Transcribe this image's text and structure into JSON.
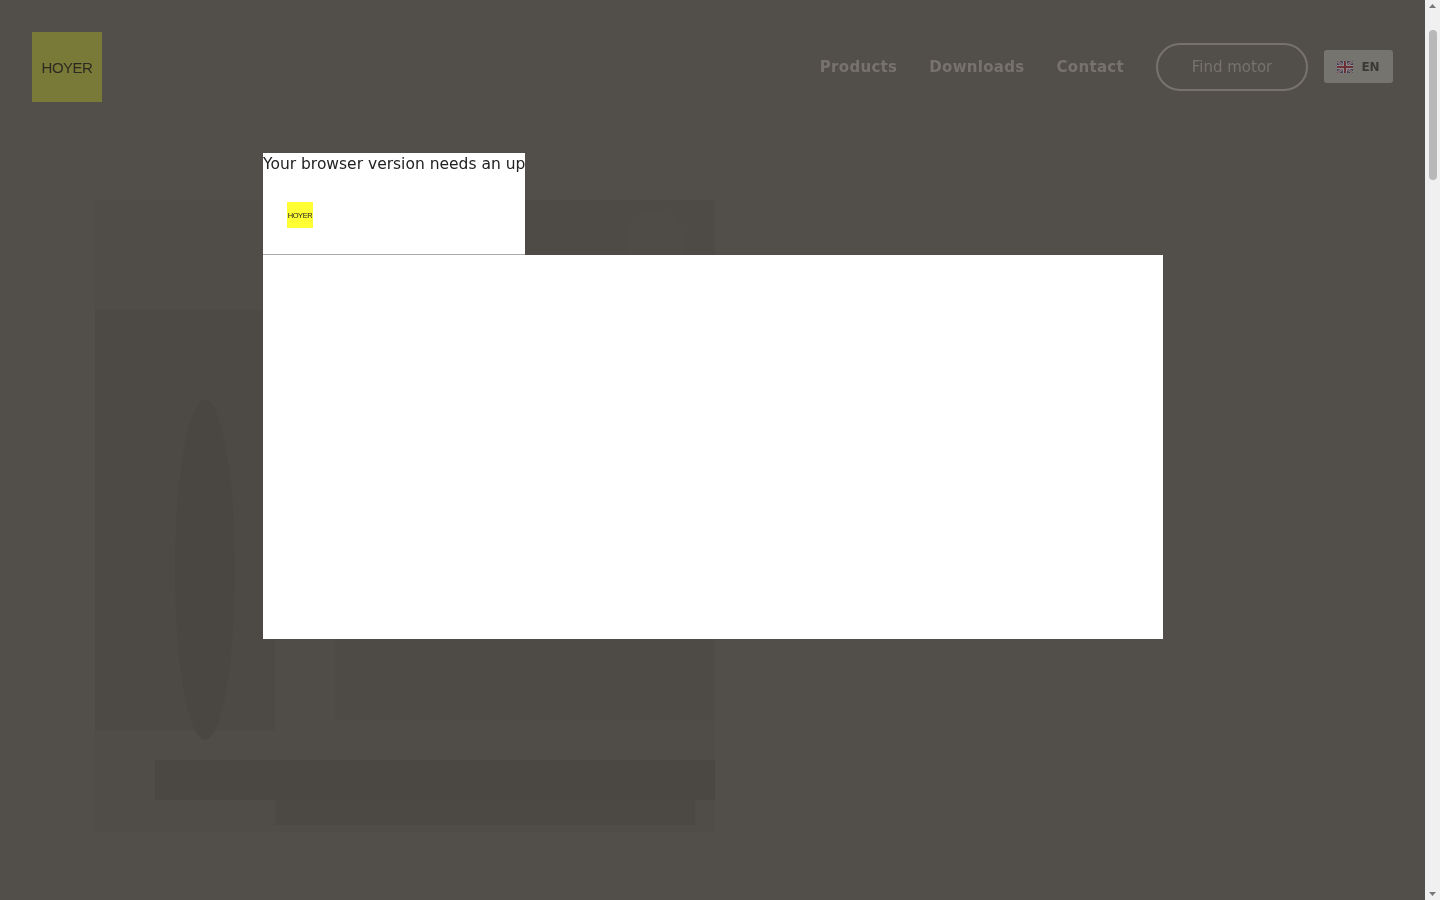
{
  "header": {
    "logo": "HOYER",
    "nav": [
      {
        "label": "Products"
      },
      {
        "label": "Downloads"
      },
      {
        "label": "Contact"
      }
    ],
    "find_button": "Find motor",
    "language": "EN"
  },
  "popup": {
    "message": "Your browser version needs an up",
    "logo": "HOYER"
  }
}
